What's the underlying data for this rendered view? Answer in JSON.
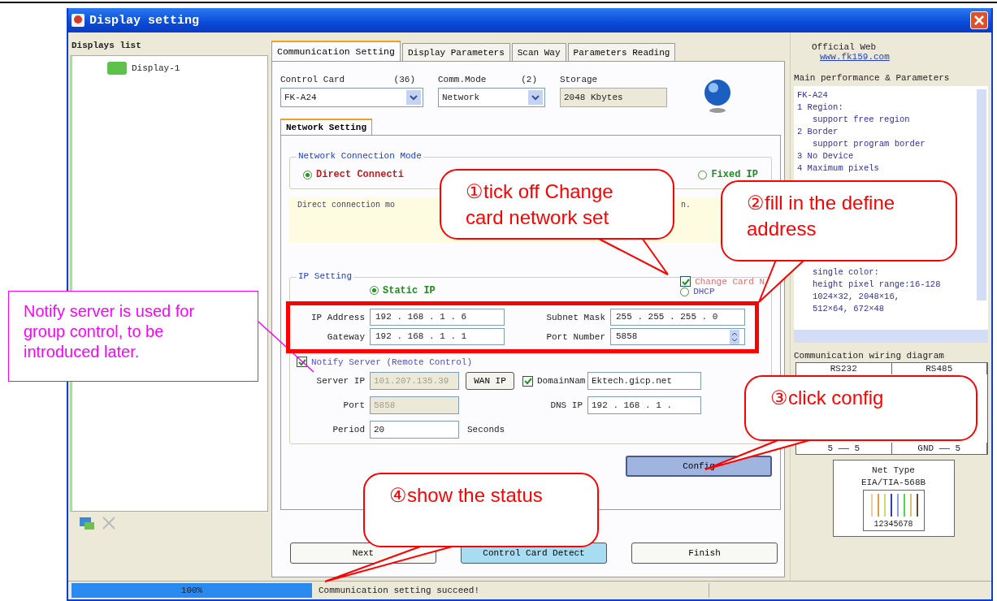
{
  "window": {
    "title": "Display setting"
  },
  "displays_list": {
    "title": "Displays list",
    "items": [
      {
        "label": "Display-1",
        "selected": false
      }
    ]
  },
  "tabs": [
    {
      "label": "Communication Setting",
      "selected": true
    },
    {
      "label": "Display Parameters",
      "selected": false
    },
    {
      "label": "Scan Way",
      "selected": false
    },
    {
      "label": "Parameters Reading",
      "selected": false
    }
  ],
  "control_card": {
    "label": "Control Card",
    "count": "(36)",
    "value": "FK-A24"
  },
  "comm_mode": {
    "label": "Comm.Mode",
    "count": "(2)",
    "value": "Network"
  },
  "storage": {
    "label": "Storage",
    "value": "2048 Kbytes"
  },
  "subtabs": [
    {
      "label": "Network Setting",
      "selected": true
    }
  ],
  "connection_mode": {
    "title": "Network Connection Mode",
    "options": [
      {
        "label": "Direct Connecti",
        "selected": true
      },
      {
        "label": "Fixed IP",
        "selected": false
      }
    ],
    "hint": "Direct connection mo",
    "hint_end": "n."
  },
  "ip_setting": {
    "title": "IP Setting",
    "static_ip": {
      "label": "Static IP",
      "selected": true
    },
    "dhcp": {
      "label": "DHCP",
      "selected": false
    },
    "change_card": {
      "label": "Change Card N",
      "checked": true
    },
    "fields": [
      {
        "label": "IP Address",
        "value": "192 . 168 . 1 . 6"
      },
      {
        "label": "Subnet Mask",
        "value": "255 . 255 . 255 . 0"
      },
      {
        "label": "Gateway",
        "value": "192 . 168 . 1 . 1"
      },
      {
        "label": "Port Number",
        "value": "5858"
      }
    ]
  },
  "notify": {
    "label": "Notify Server (Remote Control)",
    "checked": true,
    "server_ip": {
      "label": "Server IP",
      "value": "101.207.135.39",
      "disabled": true
    },
    "port": {
      "label": "Port",
      "value": "5858",
      "disabled": true
    },
    "period": {
      "label": "Period",
      "value": "20",
      "unit": "Seconds"
    },
    "wan_button": "WAN IP",
    "domain": {
      "label": "DomainNam",
      "checked": true,
      "value": "Ektech.gicp.net"
    },
    "dns": {
      "label": "DNS IP",
      "value": "192 . 168 . 1 ."
    }
  },
  "config_button": "Config",
  "buttons": [
    {
      "label": "Next",
      "focused": false
    },
    {
      "label": "Control Card Detect",
      "focused": true
    },
    {
      "label": "Finish",
      "focused": false
    }
  ],
  "info": {
    "web_label": "Official Web",
    "web_link": "www.fk159.com",
    "params_title": "Main performance & Parameters",
    "params_top": [
      "FK-A24",
      "1 Region:",
      "   support free region",
      "2 Border",
      "   support program border",
      "3 No Device",
      "4 Maximum pixels"
    ],
    "params_bottom": [
      "   single color:",
      "   height pixel range:16-128",
      "   1024×32, 2048×16,",
      "   512×64, 672×48"
    ],
    "wiring_title": "Communication wiring diagram",
    "wiring_columns": [
      "RS232",
      "RS485"
    ],
    "wiring_rows": [
      [
        "5 —— 5",
        "GND —— 5"
      ]
    ],
    "net_type": "Net Type",
    "standard": "EIA/TIA-568B",
    "pins": "12345678"
  },
  "status_bar": {
    "progress": {
      "level": 1,
      "label": "100%"
    },
    "message": "Communication setting succeed!"
  },
  "annotations": [
    {
      "kind": "callout",
      "text": "①tick off Change card network set"
    },
    {
      "kind": "callout",
      "text": "②fill in the define address"
    },
    {
      "kind": "callout",
      "text": "③click config"
    },
    {
      "kind": "callout",
      "text": "④show the status"
    },
    {
      "kind": "note",
      "text": "Notify server is used for group control, to be introduced later."
    },
    {
      "kind": "highlight"
    }
  ]
}
